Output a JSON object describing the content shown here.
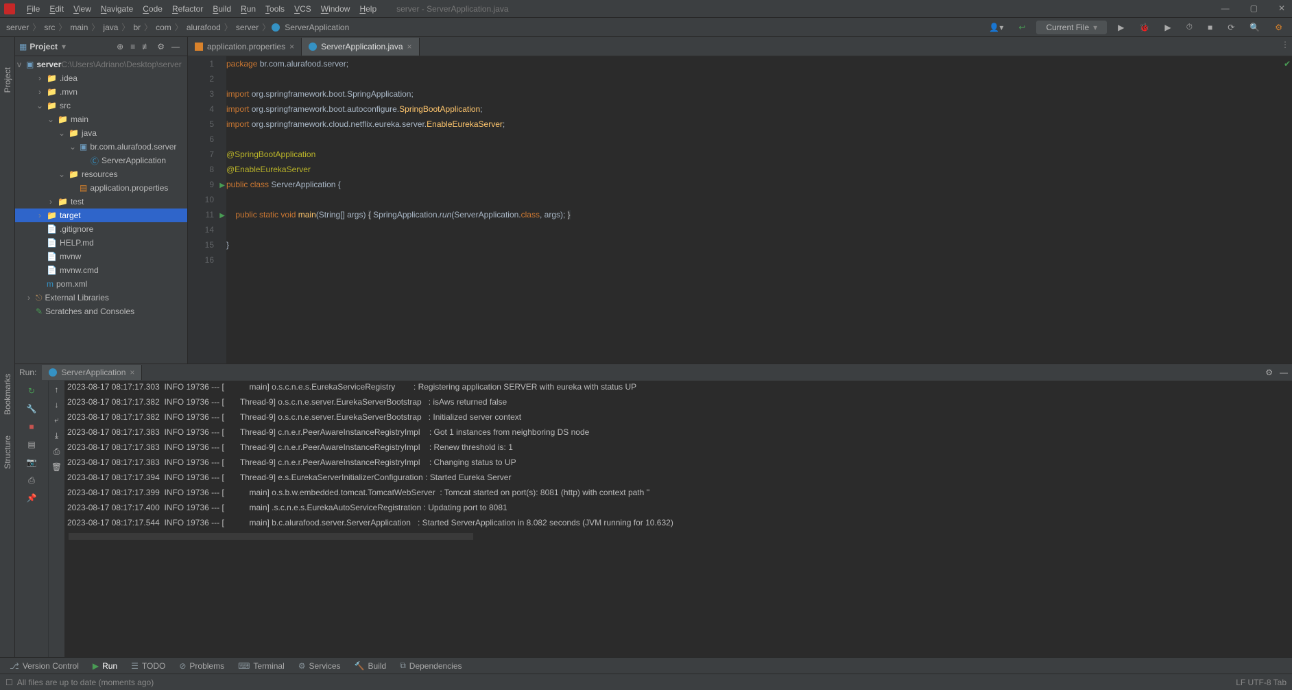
{
  "window_title": "server - ServerApplication.java",
  "menu": [
    "File",
    "Edit",
    "View",
    "Navigate",
    "Code",
    "Refactor",
    "Build",
    "Run",
    "Tools",
    "VCS",
    "Window",
    "Help"
  ],
  "breadcrumbs": [
    "server",
    "src",
    "main",
    "java",
    "br",
    "com",
    "alurafood",
    "server",
    "ServerApplication"
  ],
  "run_config": "Current File",
  "project": {
    "title": "Project",
    "root": {
      "name": "server",
      "path": "C:\\Users\\Adriano\\Desktop\\server"
    },
    "items": [
      {
        "depth": 1,
        "caret": ">",
        "icon": "folder-y",
        "name": ".idea"
      },
      {
        "depth": 1,
        "caret": ">",
        "icon": "folder-y",
        "name": ".mvn"
      },
      {
        "depth": 1,
        "caret": "v",
        "icon": "folder-b",
        "name": "src"
      },
      {
        "depth": 2,
        "caret": "v",
        "icon": "folder-b",
        "name": "main"
      },
      {
        "depth": 3,
        "caret": "v",
        "icon": "folder-b",
        "name": "java"
      },
      {
        "depth": 4,
        "caret": "v",
        "icon": "pkg",
        "name": "br.com.alurafood.server"
      },
      {
        "depth": 5,
        "caret": "",
        "icon": "class",
        "name": "ServerApplication"
      },
      {
        "depth": 3,
        "caret": "v",
        "icon": "folder-y",
        "name": "resources"
      },
      {
        "depth": 4,
        "caret": "",
        "icon": "props",
        "name": "application.properties"
      },
      {
        "depth": 2,
        "caret": ">",
        "icon": "folder-b",
        "name": "test"
      },
      {
        "depth": 1,
        "caret": ">",
        "icon": "folder-orange",
        "name": "target",
        "selected": true
      },
      {
        "depth": 1,
        "caret": "",
        "icon": "file",
        "name": ".gitignore"
      },
      {
        "depth": 1,
        "caret": "",
        "icon": "file",
        "name": "HELP.md"
      },
      {
        "depth": 1,
        "caret": "",
        "icon": "file",
        "name": "mvnw"
      },
      {
        "depth": 1,
        "caret": "",
        "icon": "file",
        "name": "mvnw.cmd"
      },
      {
        "depth": 1,
        "caret": "",
        "icon": "maven",
        "name": "pom.xml"
      },
      {
        "depth": 0,
        "caret": ">",
        "icon": "lib",
        "name": "External Libraries"
      },
      {
        "depth": 0,
        "caret": "",
        "icon": "scratch",
        "name": "Scratches and Consoles"
      }
    ]
  },
  "tabs": [
    {
      "name": "application.properties",
      "icon": "props",
      "active": false
    },
    {
      "name": "ServerApplication.java",
      "icon": "class",
      "active": true
    }
  ],
  "code": {
    "lines": [
      {
        "n": 1,
        "html": "<span class='kw'>package</span> <span class='str-pkg'>br.com.alurafood.server;</span>"
      },
      {
        "n": 2,
        "html": ""
      },
      {
        "n": 3,
        "html": "<span class='kw'>import</span> <span class='str-pkg'>org.springframework.boot.SpringApplication;</span>"
      },
      {
        "n": 4,
        "html": "<span class='kw'>import</span> <span class='str-pkg'>org.springframework.boot.autoconfigure.</span><span class='id-y'>SpringBootApplication</span><span class='str-pkg'>;</span>"
      },
      {
        "n": 5,
        "html": "<span class='kw'>import</span> <span class='str-pkg'>org.springframework.cloud.netflix.eureka.server.</span><span class='id-y'>EnableEurekaServer</span><span class='str-pkg'>;</span>"
      },
      {
        "n": 6,
        "html": ""
      },
      {
        "n": 7,
        "html": "<span class='ann'>@SpringBootApplication</span>"
      },
      {
        "n": 8,
        "html": "<span class='ann'>@EnableEurekaServer</span>"
      },
      {
        "n": 9,
        "html": "<span class='kw'>public</span> <span class='kw'>class</span> <span class='cls'>ServerApplication {</span>",
        "run": true
      },
      {
        "n": 10,
        "html": ""
      },
      {
        "n": 11,
        "html": "    <span class='kw'>public</span> <span class='kw'>static</span> <span class='kw'>void</span> <span class='id-y'>main</span><span class='cls'>(String[] args) </span><span style='background:#343638'>{</span> <span class='cls'>SpringApplication.</span><span class='static-m'>run</span><span class='cls'>(ServerApplication.</span><span class='kw'>class</span><span class='cls'>, args); </span><span style='background:#343638'>}</span>",
        "run": true
      },
      {
        "n": 14,
        "html": ""
      },
      {
        "n": 15,
        "html": "<span class='cls'>}</span>"
      },
      {
        "n": 16,
        "html": ""
      }
    ]
  },
  "run_tab": "ServerApplication",
  "run_label": "Run:",
  "console": [
    "2023-08-17 08:17:17.303  INFO 19736 --- [           main] o.s.c.n.e.s.EurekaServiceRegistry        : Registering application SERVER with eureka with status UP",
    "2023-08-17 08:17:17.382  INFO 19736 --- [       Thread-9] o.s.c.n.e.server.EurekaServerBootstrap   : isAws returned false",
    "2023-08-17 08:17:17.382  INFO 19736 --- [       Thread-9] o.s.c.n.e.server.EurekaServerBootstrap   : Initialized server context",
    "2023-08-17 08:17:17.383  INFO 19736 --- [       Thread-9] c.n.e.r.PeerAwareInstanceRegistryImpl    : Got 1 instances from neighboring DS node",
    "2023-08-17 08:17:17.383  INFO 19736 --- [       Thread-9] c.n.e.r.PeerAwareInstanceRegistryImpl    : Renew threshold is: 1",
    "2023-08-17 08:17:17.383  INFO 19736 --- [       Thread-9] c.n.e.r.PeerAwareInstanceRegistryImpl    : Changing status to UP",
    "2023-08-17 08:17:17.394  INFO 19736 --- [       Thread-9] e.s.EurekaServerInitializerConfiguration : Started Eureka Server",
    "2023-08-17 08:17:17.399  INFO 19736 --- [           main] o.s.b.w.embedded.tomcat.TomcatWebServer  : Tomcat started on port(s): 8081 (http) with context path ''",
    "2023-08-17 08:17:17.400  INFO 19736 --- [           main] .s.c.n.e.s.EurekaAutoServiceRegistration : Updating port to 8081",
    "2023-08-17 08:17:17.544  INFO 19736 --- [           main] b.c.alurafood.server.ServerApplication   : Started ServerApplication in 8.082 seconds (JVM running for 10.632)"
  ],
  "bottom_tools": [
    "Version Control",
    "Run",
    "TODO",
    "Problems",
    "Terminal",
    "Services",
    "Build",
    "Dependencies"
  ],
  "status_left": "All files are up to date (moments ago)",
  "status_right": "LF  UTF-8  Tab"
}
